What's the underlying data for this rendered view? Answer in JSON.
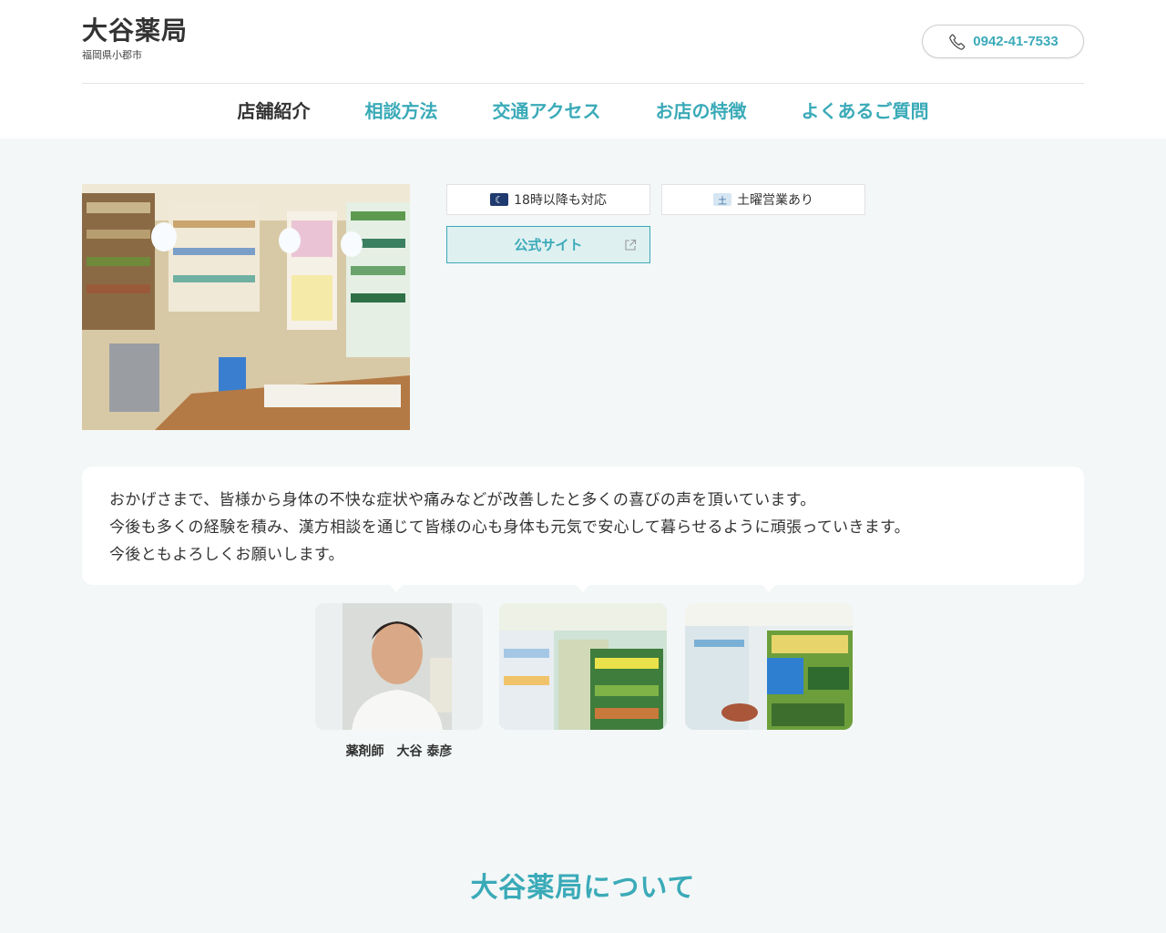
{
  "header": {
    "brand_name": "大谷薬局",
    "brand_location": "福岡県小郡市",
    "phone": "0942-41-7533",
    "phone_icon": "phone-icon"
  },
  "nav": {
    "items": [
      {
        "label": "店舗紹介",
        "active": true
      },
      {
        "label": "相談方法",
        "active": false
      },
      {
        "label": "交通アクセス",
        "active": false
      },
      {
        "label": "お店の特徴",
        "active": false
      },
      {
        "label": "よくあるご質問",
        "active": false
      }
    ]
  },
  "badges": {
    "evening": {
      "label": "18時以降も対応",
      "icon": "moon-icon",
      "icon_glyph": "☾"
    },
    "saturday": {
      "label": "土曜営業あり",
      "icon": "saturday-icon",
      "icon_glyph": "土"
    }
  },
  "official_site": {
    "label": "公式サイト",
    "icon": "external-link-icon"
  },
  "message": {
    "lines": [
      "おかげさまで、皆様から身体の不快な症状や痛みなどが改善したと多くの喜びの声を頂いています。",
      "今後も多くの経験を積み、漢方相談を通じて皆様の心も身体も元気で安心して暮らせるように頑張っていきます。",
      "今後ともよろしくお願いします。"
    ]
  },
  "staff": {
    "caption": "薬剤師　大谷 泰彦"
  },
  "about": {
    "title": "大谷薬局について"
  },
  "colors": {
    "accent": "#3aaab8",
    "background": "#f3f7f7",
    "text": "#333333"
  }
}
